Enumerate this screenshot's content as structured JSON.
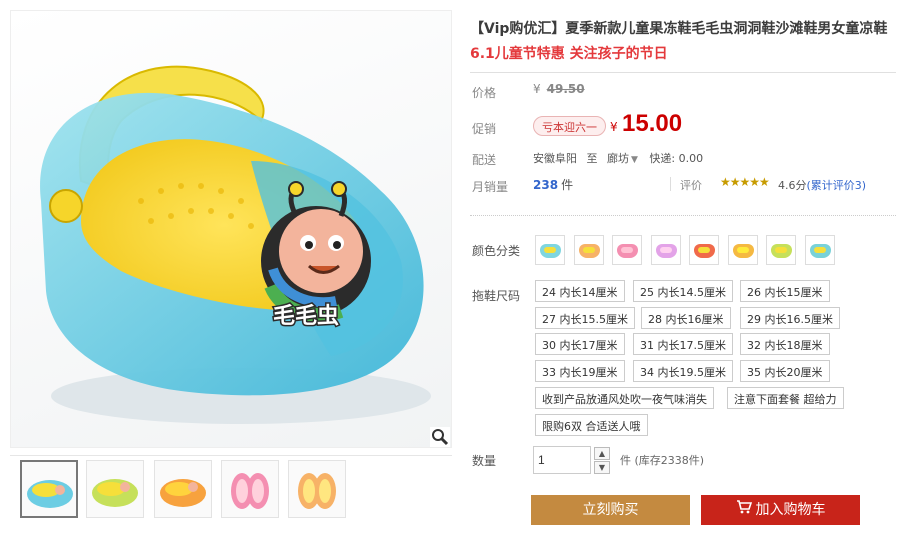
{
  "product": {
    "title": "【Vip购优汇】夏季新款儿童果冻鞋毛毛虫洞洞鞋沙滩鞋男女童凉鞋",
    "subtitle": "6.1儿童节特惠 关注孩子的节日",
    "image_badge_text": "毛毛虫"
  },
  "price": {
    "orig_label": "价格",
    "orig_currency": "¥",
    "orig_value": "49.50",
    "promo_label": "促销",
    "promo_badge": "亏本迎六一",
    "currency": "¥",
    "value": "15.00"
  },
  "shipping": {
    "label": "配送",
    "from": "安徽阜阳",
    "to_word": "至",
    "destination": "廊坊",
    "fee": "快递: 0.00"
  },
  "sales": {
    "label": "月销量",
    "count": "238",
    "unit": "件",
    "rating_label": "评价",
    "stars": "★★★★★",
    "score": "4.6分",
    "reviews_link": "(累计评价3)"
  },
  "colors": {
    "label": "颜色分类",
    "swatches": [
      "#7fd6e0",
      "#f7b267",
      "#f48fb1",
      "#e3a3e8",
      "#f06a4a",
      "#f5b942",
      "#c6e05a",
      "#79d2d9"
    ],
    "soles": [
      "#f6df3a",
      "#f6df3a",
      "#ffc2d4",
      "#ffd1f0",
      "#f6df3a",
      "#ffeb3b",
      "#f6df3a",
      "#f6df3a"
    ]
  },
  "sizes": {
    "label": "拖鞋尺码",
    "options": [
      "24 内长14厘米",
      "25 内长14.5厘米",
      "26 内长15厘米",
      "27 内长15.5厘米",
      "28 内长16厘米",
      "29 内长16.5厘米",
      "30 内长17厘米",
      "31 内长17.5厘米",
      "32 内长18厘米",
      "33 内长19厘米",
      "34 内长19.5厘米",
      "35 内长20厘米",
      "收到产品放通风处吹一夜气味消失",
      "注意下面套餐 超给力",
      "限购6双 合适送人哦"
    ]
  },
  "quantity": {
    "label": "数量",
    "value": "1",
    "unit": "件",
    "stock": "(库存2338件)"
  },
  "actions": {
    "buy_now": "立刻购买",
    "add_to_cart": "加入购物车"
  },
  "colors_theme": {
    "accent_red": "#c00",
    "buy_btn": "#c48a40",
    "cart_btn": "#c8241a"
  }
}
